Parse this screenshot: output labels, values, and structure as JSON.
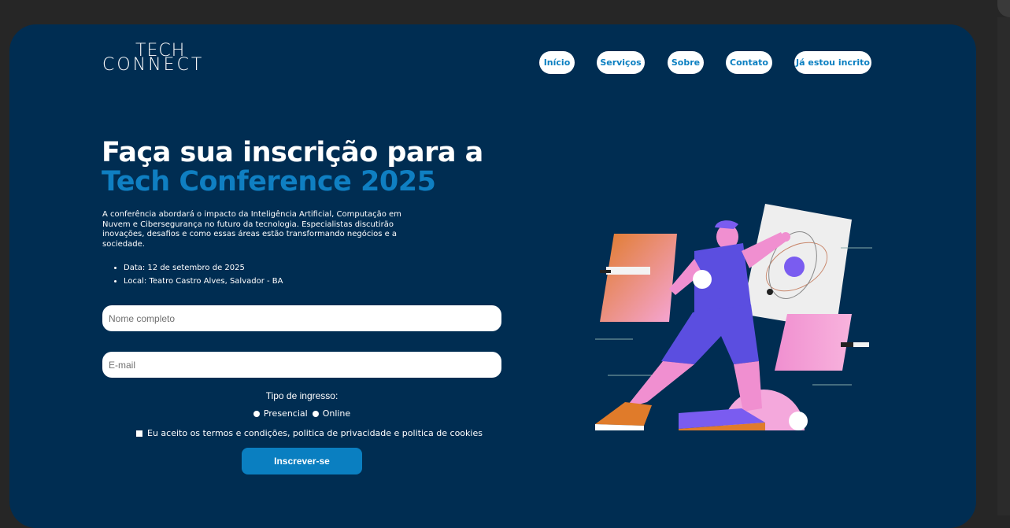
{
  "logo": {
    "line1": "TECH",
    "line2": "CONNECT"
  },
  "nav": {
    "items": [
      {
        "label": "Início"
      },
      {
        "label": "Serviços"
      },
      {
        "label": "Sobre"
      },
      {
        "label": "Contato"
      },
      {
        "label": "Já estou incrito"
      }
    ]
  },
  "hero": {
    "title_line1": "Faça sua inscrição para a",
    "title_line2": "Tech Conference 2025",
    "description": "A conferência abordará o impacto da Inteligência Artificial, Computação em Nuvem e Cibersegurança no futuro da tecnologia. Especialistas discutirão inovações, desafios e como essas áreas estão transformando negócios e a sociedade.",
    "bullets": [
      "Data: 12 de setembro de 2025",
      "Local: Teatro Castro Alves, Salvador - BA"
    ]
  },
  "form": {
    "name_placeholder": "Nome completo",
    "email_placeholder": "E-mail",
    "ticket_label": "Tipo de ingresso:",
    "ticket_options": [
      "Presencial",
      "Online"
    ],
    "terms_label": "Eu aceito os termos e condições, politica de privacidade e politica de cookies",
    "submit_label": "Inscrever-se"
  },
  "colors": {
    "card_bg": "#002d52",
    "accent": "#0a7fc1",
    "page_bg": "#262626"
  },
  "icons": {
    "illustration": "person-interacting-with-holographic-screens"
  }
}
